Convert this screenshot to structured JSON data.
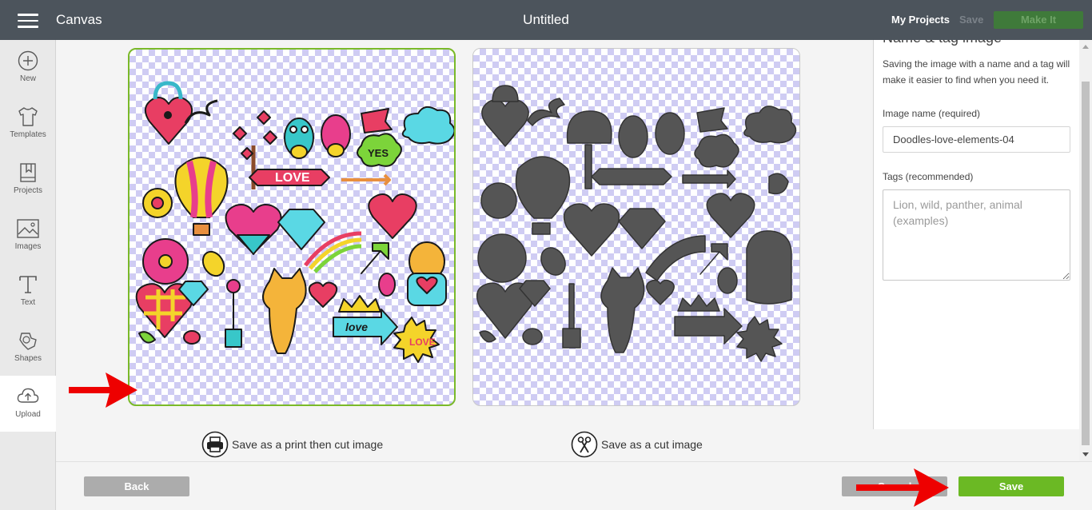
{
  "app": {
    "brand": "Canvas",
    "title": "Untitled"
  },
  "topbar": {
    "my_projects": "My Projects",
    "save": "Save",
    "make_it": "Make It"
  },
  "sidebar": {
    "items": [
      {
        "label": "New",
        "icon": "plus-circle-icon"
      },
      {
        "label": "Templates",
        "icon": "tshirt-icon"
      },
      {
        "label": "Projects",
        "icon": "bookmark-icon"
      },
      {
        "label": "Images",
        "icon": "image-icon"
      },
      {
        "label": "Text",
        "icon": "text-icon"
      },
      {
        "label": "Shapes",
        "icon": "shapes-icon"
      },
      {
        "label": "Upload",
        "icon": "cloud-upload-icon"
      }
    ]
  },
  "options": {
    "print_then_cut": "Save as a print then cut image",
    "cut": "Save as a cut image"
  },
  "right_panel": {
    "heading": "Name & tag image",
    "description": "Saving the image with a name and a tag will make it easier to find when you need it.",
    "name_label": "Image name (required)",
    "name_value": "Doodles-love-elements-04",
    "tags_label": "Tags (recommended)",
    "tags_placeholder": "Lion, wild, panther, animal (examples)"
  },
  "footer": {
    "back": "Back",
    "cancel": "Cancel",
    "save": "Save"
  },
  "colors": {
    "topbar": "#4c545c",
    "accent_green": "#6bb924",
    "selected_border": "#7ab929",
    "annotation_red": "#ee0000",
    "silhouette": "#555555"
  }
}
